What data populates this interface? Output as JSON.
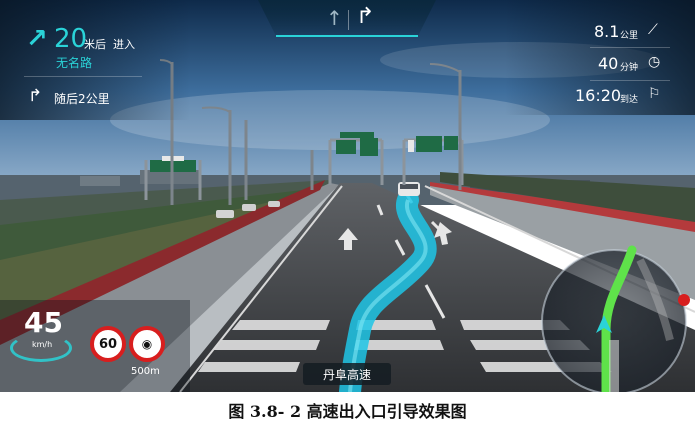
{
  "nav": {
    "distance_value": "20",
    "distance_unit": "米后",
    "action": "进入",
    "road": "无名路",
    "next_hint": "随后2公里",
    "top_lane_icons": [
      "straight-arrow-icon",
      "turn-right-arrow-icon"
    ]
  },
  "trip": {
    "remaining_distance": "8.1",
    "remaining_distance_unit": "公里",
    "remaining_time": "40",
    "remaining_time_unit": "分钟",
    "arrival_time": "16:20",
    "arrival_label": "到达"
  },
  "speed": {
    "value": "45",
    "unit": "km/h"
  },
  "signs": {
    "speed_limit": "60",
    "camera_distance": "500m"
  },
  "current_road": "丹阜高速",
  "caption": "图 3.8- 2 高速出入口引导效果图",
  "colors": {
    "accent": "#2ad3d8",
    "route": "#1fc6e6",
    "minimap_route": "#5fe24a",
    "warning_red": "#d81e1e"
  }
}
